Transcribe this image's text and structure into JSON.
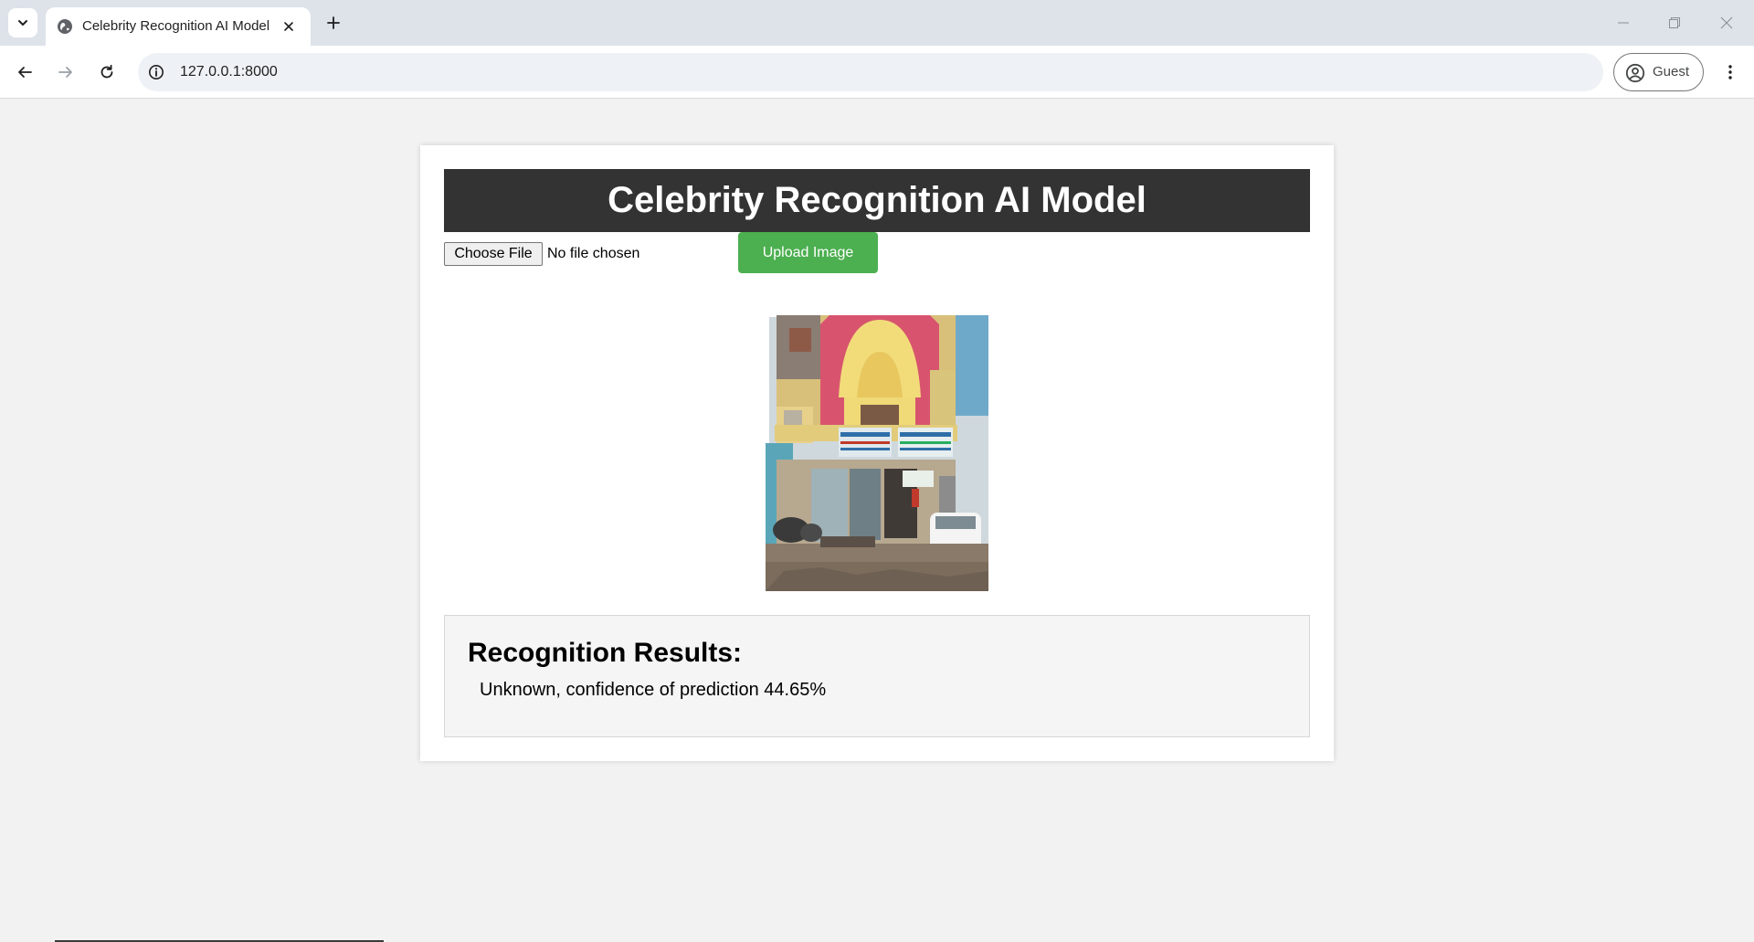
{
  "browser": {
    "tab_title": "Celebrity Recognition AI Model",
    "url": "127.0.0.1:8000",
    "profile_label": "Guest"
  },
  "page": {
    "header_title": "Celebrity Recognition AI Model",
    "choose_file_label": "Choose File",
    "file_status": "No file chosen",
    "upload_button_label": "Upload Image",
    "results_title": "Recognition Results:",
    "results_text": "Unknown, confidence of prediction 44.65%"
  },
  "colors": {
    "header_bg": "#333333",
    "upload_button": "#4caf50",
    "page_bg": "#f2f2f2",
    "results_bg": "#f5f5f5"
  },
  "icons": {
    "tab_search": "chevron-down-icon",
    "favicon": "globe-icon",
    "tab_close": "close-icon",
    "new_tab": "plus-icon",
    "back": "arrow-left-icon",
    "forward": "arrow-right-icon",
    "reload": "reload-icon",
    "site_info": "info-icon",
    "profile": "person-circle-icon",
    "menu": "kebab-menu-icon",
    "minimize": "minimize-icon",
    "restore": "restore-icon",
    "close_window": "close-window-icon"
  }
}
